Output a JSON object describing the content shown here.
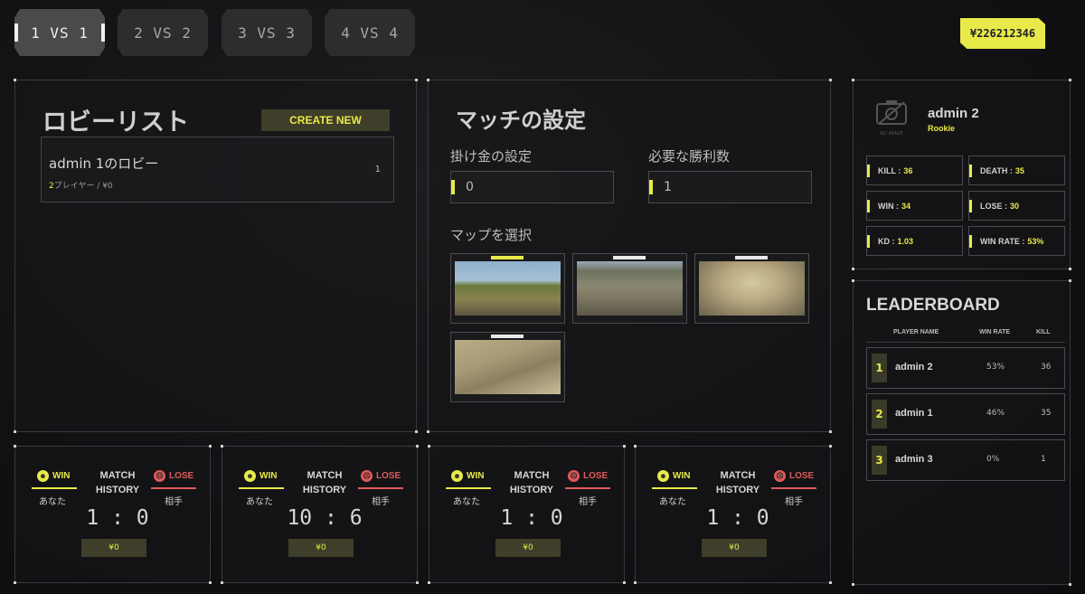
{
  "modes": [
    {
      "label": "1 VS 1",
      "active": true
    },
    {
      "label": "2 VS 2",
      "active": false
    },
    {
      "label": "3 VS 3",
      "active": false
    },
    {
      "label": "4 VS 4",
      "active": false
    }
  ],
  "balance": "¥226212346",
  "lobby": {
    "title": "ロビーリスト",
    "create_label": "CREATE NEW",
    "items": [
      {
        "name": "admin 1のロビー",
        "player_count": "2",
        "meta_rest": "プレイヤー / ¥0",
        "number": "1"
      }
    ]
  },
  "match_settings": {
    "title": "マッチの設定",
    "wager_label": "掛け金の設定",
    "wager_value": "0",
    "wins_label": "必要な勝利数",
    "wins_value": "1",
    "map_label": "マップを選択"
  },
  "profile": {
    "no_image": "NO IMAGE",
    "name": "admin 2",
    "rank": "Rookie",
    "stats": [
      {
        "label": "KILL :",
        "value": "36"
      },
      {
        "label": "DEATH :",
        "value": "35"
      },
      {
        "label": "WIN :",
        "value": "34"
      },
      {
        "label": "LOSE :",
        "value": "30"
      },
      {
        "label": "KD :",
        "value": "1.03"
      },
      {
        "label": "WIN RATE :",
        "value": "53%"
      }
    ]
  },
  "leaderboard": {
    "title": "LEADERBOARD",
    "headers": {
      "name": "PLAYER NAME",
      "rate": "WIN RATE",
      "kill": "KILL"
    },
    "rows": [
      {
        "rank": "1",
        "name": "admin 2",
        "rate": "53%",
        "kill": "36"
      },
      {
        "rank": "2",
        "name": "admin 1",
        "rate": "46%",
        "kill": "35"
      },
      {
        "rank": "3",
        "name": "admin 3",
        "rate": "0%",
        "kill": "1"
      }
    ]
  },
  "history": [
    {
      "win": "WIN",
      "lose": "LOSE",
      "title1": "MATCH",
      "title2": "HISTORY",
      "you": "あなた",
      "opp": "相手",
      "score": "1 : 0",
      "prize": "¥0"
    },
    {
      "win": "WIN",
      "lose": "LOSE",
      "title1": "MATCH",
      "title2": "HISTORY",
      "you": "あなた",
      "opp": "相手",
      "score": "10 : 6",
      "prize": "¥0"
    },
    {
      "win": "WIN",
      "lose": "LOSE",
      "title1": "MATCH",
      "title2": "HISTORY",
      "you": "あなた",
      "opp": "相手",
      "score": "1 : 0",
      "prize": "¥0"
    },
    {
      "win": "WIN",
      "lose": "LOSE",
      "title1": "MATCH",
      "title2": "HISTORY",
      "you": "あなた",
      "opp": "相手",
      "score": "1 : 0",
      "prize": "¥0"
    }
  ],
  "colors": {
    "accent": "#e8ea4a",
    "lose": "#e05a5a",
    "panel_border": "#3a3a3e"
  }
}
